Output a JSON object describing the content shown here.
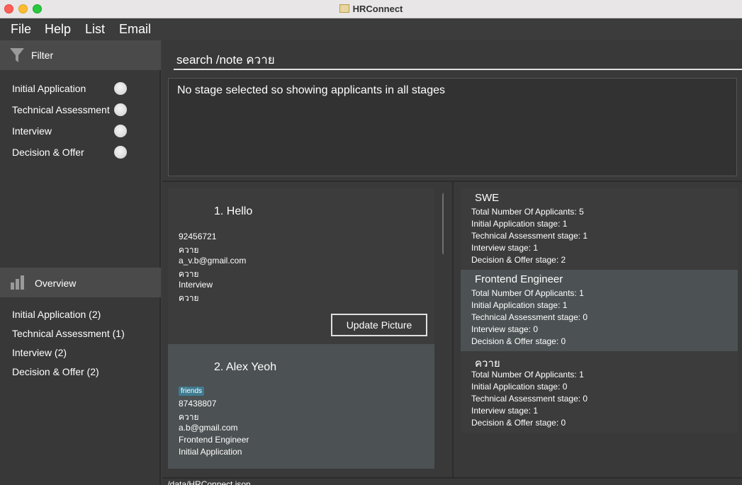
{
  "window": {
    "title": "HRConnect"
  },
  "menu": {
    "items": [
      "File",
      "Help",
      "List",
      "Email"
    ]
  },
  "sidebar": {
    "filter_label": "Filter",
    "filters": [
      "Initial Application",
      "Technical Assessment",
      "Interview",
      "Decision & Offer"
    ],
    "overview_label": "Overview",
    "overview": [
      "Initial Application (2)",
      "Technical Assessment (1)",
      "Interview (2)",
      "Decision & Offer (2)"
    ]
  },
  "command": {
    "value": "search /note ควาย"
  },
  "result": {
    "text": "No stage selected so showing applicants in all stages"
  },
  "applicants": [
    {
      "title": "1.  Hello",
      "tags": [],
      "lines": [
        "92456721",
        "ควาย",
        "a_v.b@gmail.com",
        "ควาย",
        "Interview",
        "ควาย"
      ],
      "button": "Update Picture"
    },
    {
      "title": "2.  Alex Yeoh",
      "tags": [
        "friends"
      ],
      "lines": [
        "87438807",
        "ควาย",
        "a.b@gmail.com",
        "Frontend Engineer",
        "Initial Application"
      ]
    }
  ],
  "jobs": [
    {
      "title": "SWE",
      "lines": [
        "Total Number Of Applicants: 5",
        "Initial Application stage: 1",
        "Technical Assessment stage: 1",
        "Interview stage: 1",
        "Decision & Offer stage: 2"
      ]
    },
    {
      "title": "Frontend Engineer",
      "lines": [
        "Total Number Of Applicants: 1",
        "Initial Application stage: 1",
        "Technical Assessment stage: 0",
        "Interview stage: 0",
        "Decision & Offer stage: 0"
      ]
    },
    {
      "title": "ควาย",
      "lines": [
        "Total Number Of Applicants: 1",
        "Initial Application stage: 0",
        "Technical Assessment stage: 0",
        "Interview stage: 1",
        "Decision & Offer stage: 0"
      ]
    }
  ],
  "status": {
    "text": "./data/HRConnect.json"
  }
}
